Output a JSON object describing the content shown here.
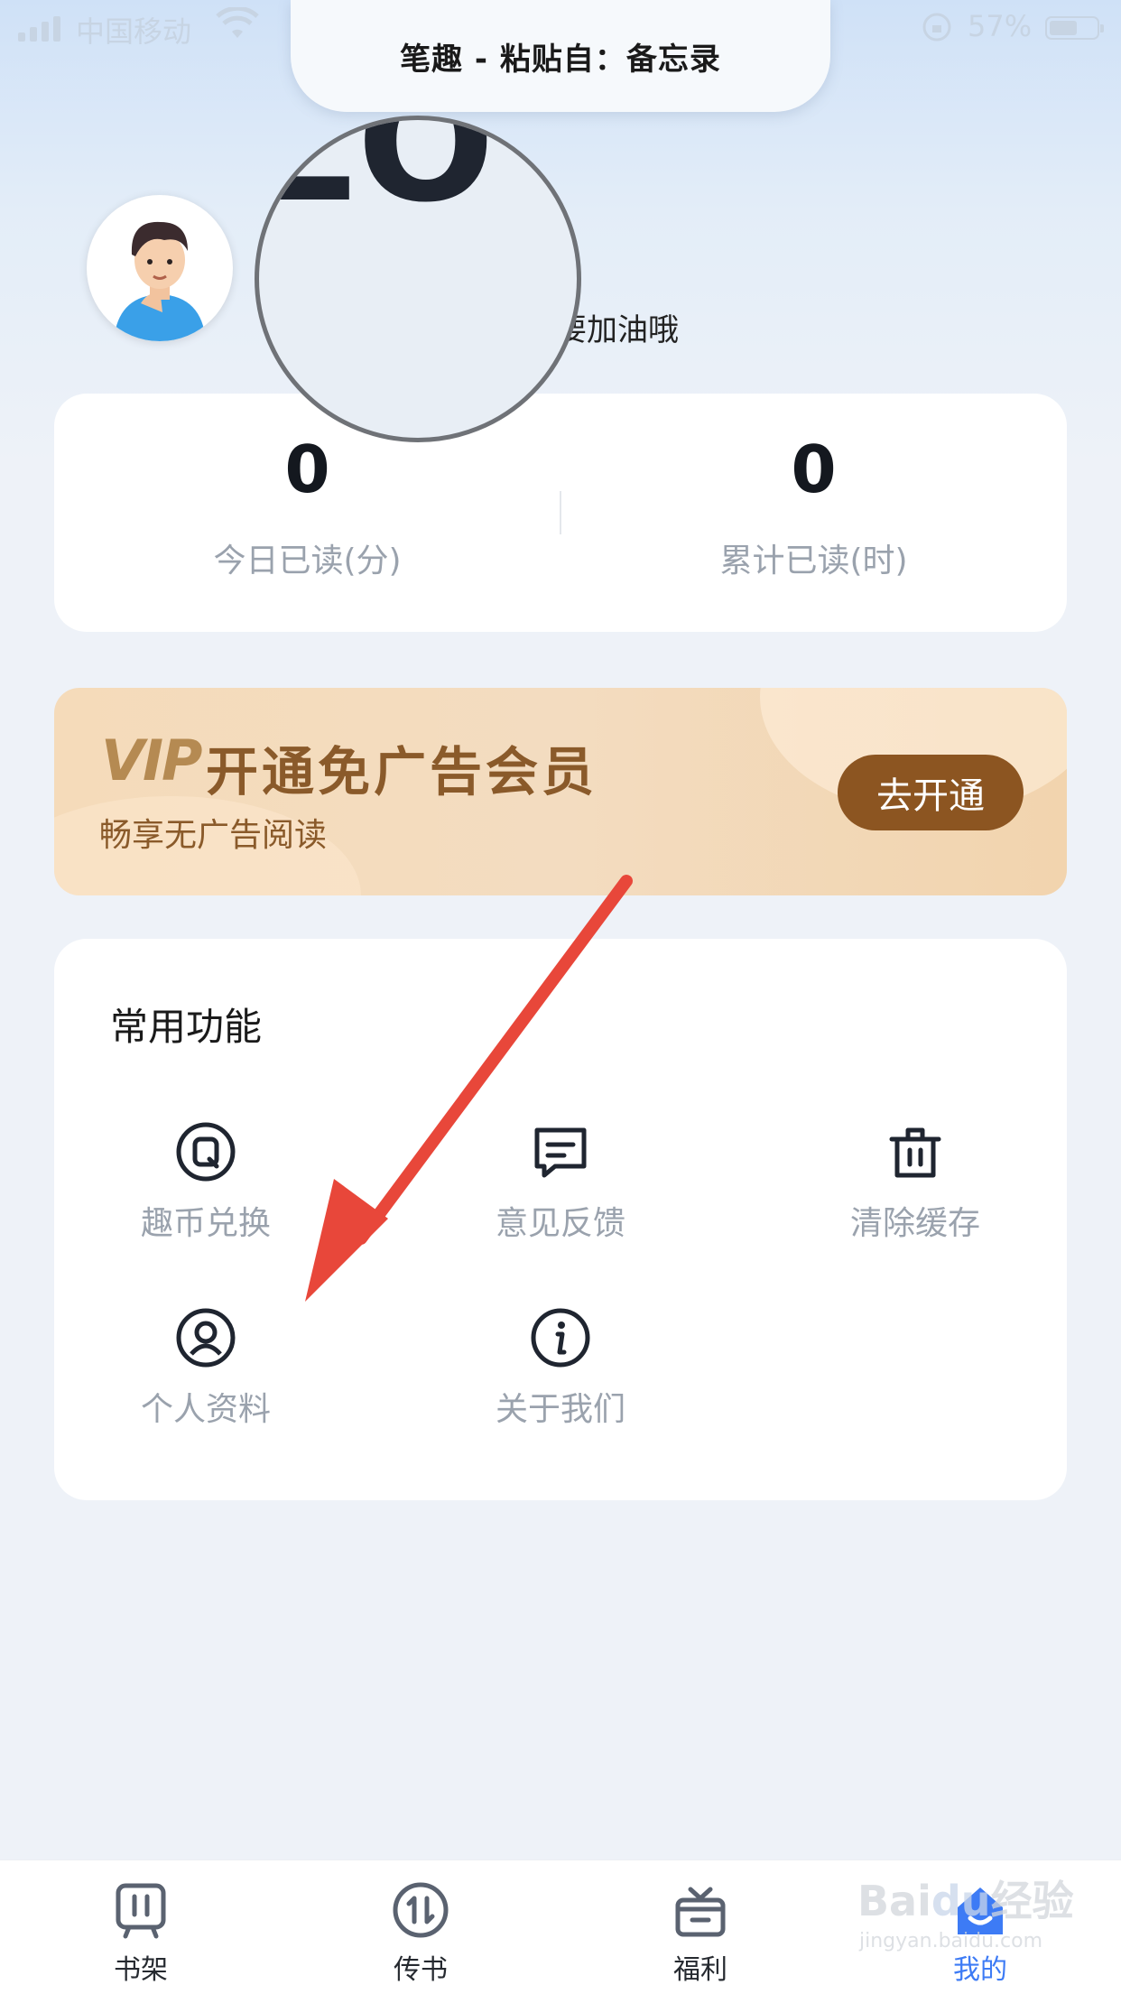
{
  "status_bar": {
    "carrier": "中国移动",
    "battery": "57%"
  },
  "banner": {
    "text": "笔趣 - 粘贴自：备忘录"
  },
  "profile": {
    "greeting_partial": "要加油哦"
  },
  "stats": [
    {
      "value": "0",
      "label": "今日已读(分)"
    },
    {
      "value": "0",
      "label": "累计已读(时)"
    }
  ],
  "vip": {
    "mark": "VIP",
    "title": "开通免广告会员",
    "subtitle": "畅享无广告阅读",
    "button": "去开通"
  },
  "features": {
    "title": "常用功能",
    "items": [
      {
        "label": "趣币兑换",
        "icon": "coin-exchange-icon"
      },
      {
        "label": "意见反馈",
        "icon": "feedback-icon"
      },
      {
        "label": "清除缓存",
        "icon": "trash-icon"
      },
      {
        "label": "个人资料",
        "icon": "user-profile-icon"
      },
      {
        "label": "关于我们",
        "icon": "info-icon"
      }
    ]
  },
  "tabbar": {
    "items": [
      {
        "label": "书架",
        "icon": "bookshelf-icon"
      },
      {
        "label": "传书",
        "icon": "transfer-icon"
      },
      {
        "label": "福利",
        "icon": "gift-icon"
      },
      {
        "label": "我的",
        "icon": "home-user-icon",
        "active": true
      }
    ]
  },
  "colors": {
    "accent": "#3d7bf5",
    "vip_button": "#8c5521",
    "annotation_arrow": "#e8473a"
  }
}
